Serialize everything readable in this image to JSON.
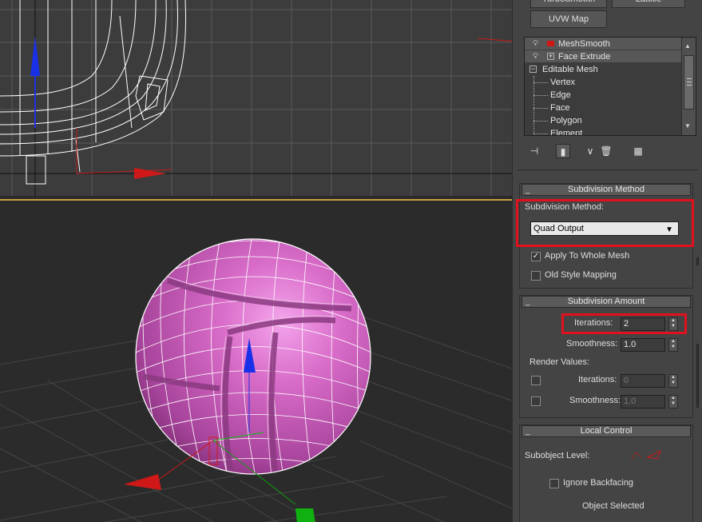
{
  "command_panel": {
    "top_buttons": {
      "turbosmooth": "TurboSmooth",
      "lattice": "Lattice",
      "uvw_map": "UVW Map"
    },
    "modifier_stack": {
      "modifiers": [
        {
          "label": "MeshSmooth",
          "icon": "lightbulb-icon"
        },
        {
          "label": "Face Extrude",
          "icon": "lightbulb-icon"
        }
      ],
      "base_object": "Editable Mesh",
      "sub_objects": [
        "Vertex",
        "Edge",
        "Face",
        "Polygon",
        "Element"
      ]
    },
    "stack_tools": [
      "pin-stack-icon",
      "show-end-result-icon",
      "make-unique-icon",
      "remove-modifier-icon",
      "configure-modifier-sets-icon"
    ],
    "subdivision_method": {
      "title": "Subdivision Method",
      "method_label": "Subdivision Method:",
      "method_value": "Quad Output",
      "apply_whole_mesh": {
        "label": "Apply To Whole Mesh",
        "checked": true
      },
      "old_style_mapping": {
        "label": "Old Style Mapping",
        "checked": false
      }
    },
    "subdivision_amount": {
      "title": "Subdivision Amount",
      "iterations_label": "Iterations:",
      "iterations_value": "2",
      "smoothness_label": "Smoothness:",
      "smoothness_value": "1.0",
      "render_values_label": "Render Values:",
      "render_iterations_label": "Iterations:",
      "render_iterations_value": "0",
      "render_smoothness_label": "Smoothness:",
      "render_smoothness_value": "1.0"
    },
    "local_control": {
      "title": "Local Control",
      "subobject_level_label": "Subobject Level:",
      "ignore_backfacing": {
        "label": "Ignore Backfacing",
        "checked": false
      },
      "status_text": "Object Selected"
    }
  },
  "colors": {
    "highlight": "#e0101c",
    "active_viewport_border": "#c8a03c",
    "mesh_color": "#c85ab4",
    "wireframe": "#ffffff"
  }
}
